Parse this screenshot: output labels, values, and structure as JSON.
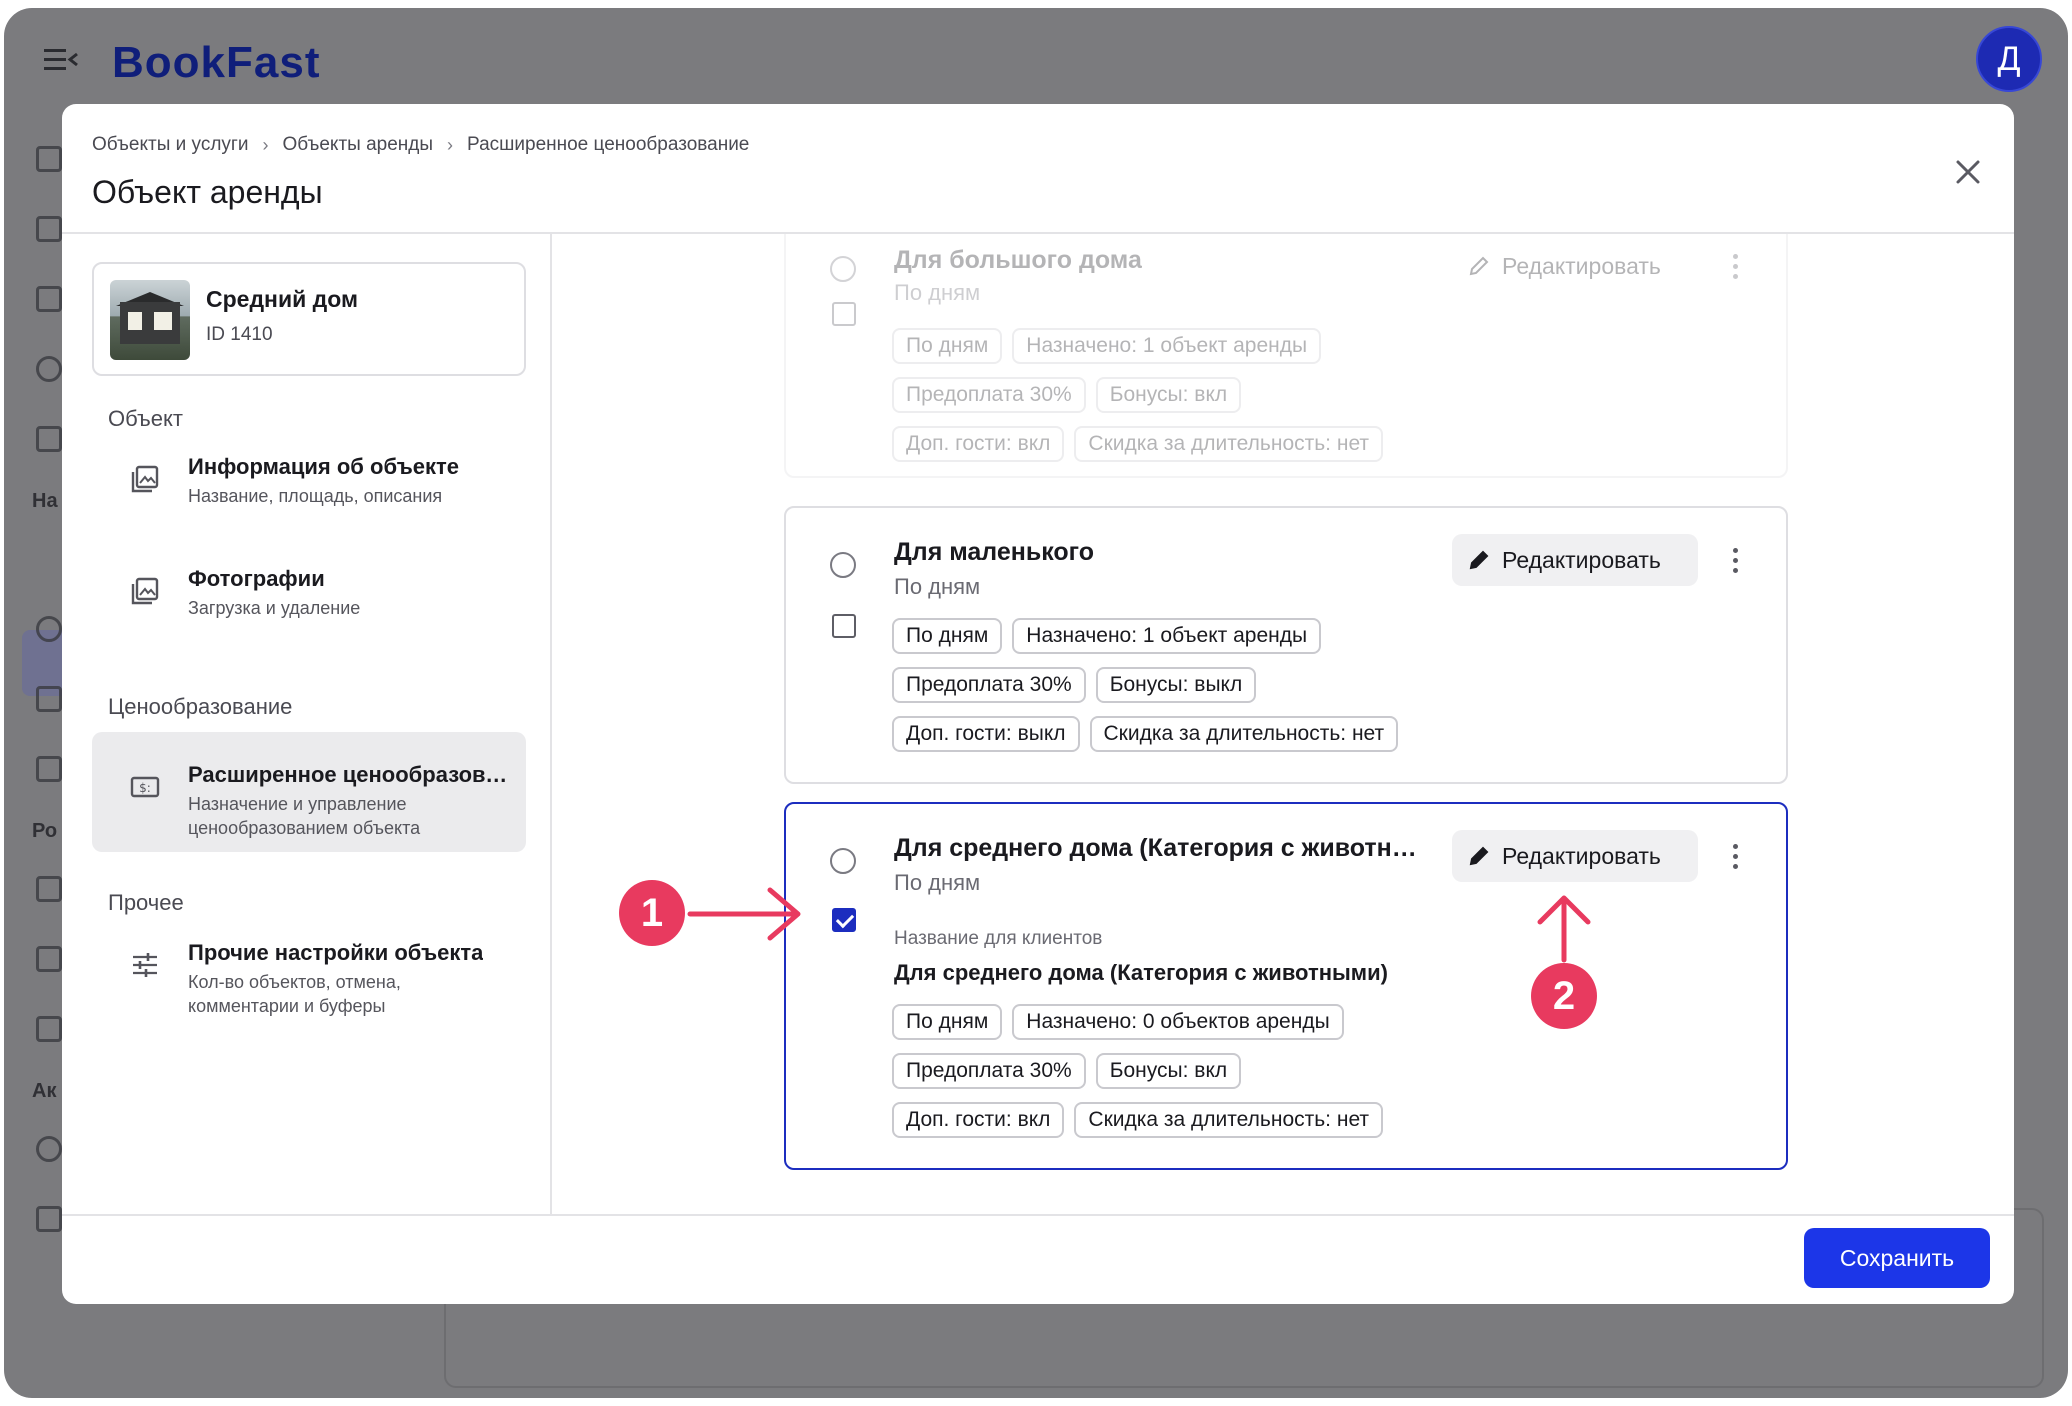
{
  "app": {
    "logo": "BookFast",
    "user_initial": "Д"
  },
  "bg_sidebar": {
    "section_labels": [
      "На",
      "Ро",
      "Ак"
    ]
  },
  "modal": {
    "breadcrumb": [
      "Объекты и услуги",
      "Объекты аренды",
      "Расширенное ценообразование"
    ],
    "title": "Объект аренды"
  },
  "object": {
    "name": "Средний дом",
    "id": "ID 1410"
  },
  "nav": {
    "section_object": "Объект",
    "info_title": "Информация об объекте",
    "info_sub": "Название, площадь, описания",
    "photos_title": "Фотографии",
    "photos_sub": "Загрузка и удаление",
    "section_pricing": "Ценообразование",
    "pricing_title": "Расширенное ценообразование",
    "pricing_sub": "Назначение и управление ценообразованием объекта",
    "section_other": "Прочее",
    "other_title": "Прочие настройки объекта",
    "other_sub": "Кол-во объектов, отмена, комментарии и буферы"
  },
  "tariffs": [
    {
      "name": "Для большого дома",
      "type": "По дням",
      "edit_label": "Редактировать",
      "chips_row1": [
        "По дням",
        "Назначено: 1 объект аренды"
      ],
      "chips_row2": [
        "Предоплата 30%",
        "Бонусы: вкл"
      ],
      "chips_row3": [
        "Доп. гости: вкл",
        "Скидка за длительность: нет"
      ]
    },
    {
      "name": "Для маленького",
      "type": "По дням",
      "edit_label": "Редактировать",
      "chips_row1": [
        "По дням",
        "Назначено: 1 объект аренды"
      ],
      "chips_row2": [
        "Предоплата 30%",
        "Бонусы: выкл"
      ],
      "chips_row3": [
        "Доп. гости: выкл",
        "Скидка за длительность: нет"
      ]
    },
    {
      "name": "Для среднего дома (Категория с животными)",
      "type": "По дням",
      "edit_label": "Редактировать",
      "client_label": "Название для клиентов",
      "client_name": "Для среднего дома (Категория с животными)",
      "chips_row1": [
        "По дням",
        "Назначено: 0 объектов аренды"
      ],
      "chips_row2": [
        "Предоплата 30%",
        "Бонусы: вкл"
      ],
      "chips_row3": [
        "Доп. гости: вкл",
        "Скидка за длительность: нет"
      ]
    }
  ],
  "footer": {
    "save_label": "Сохранить"
  },
  "annotations": [
    "1",
    "2"
  ],
  "colors": {
    "accent": "#1c36e8",
    "selected_border": "#1c2dbf",
    "annotation": "#e83a5f",
    "avatar": "#1d2ab3"
  }
}
